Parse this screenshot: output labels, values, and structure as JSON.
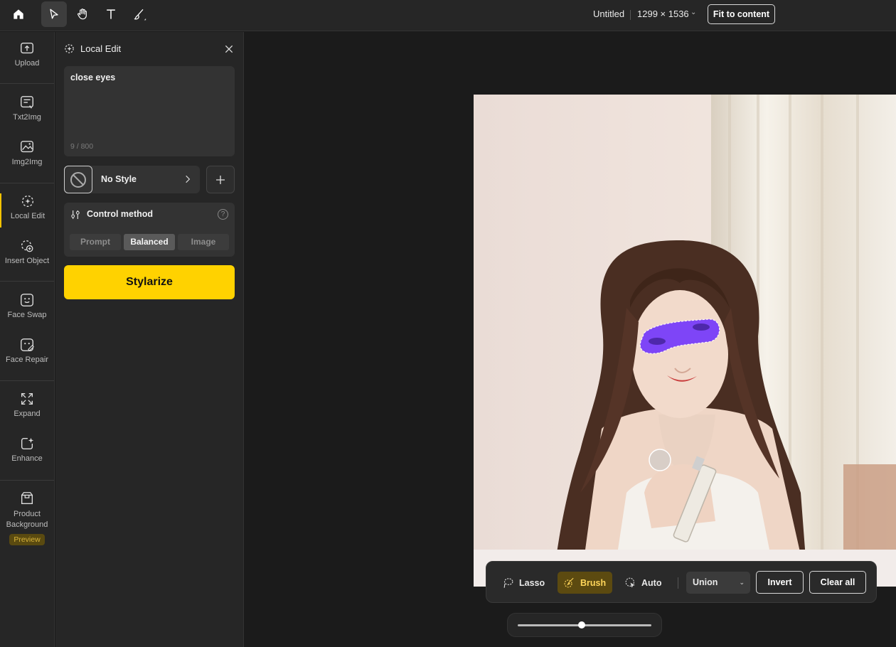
{
  "toolbar": {
    "tools": [
      {
        "icon": "home-icon"
      },
      {
        "icon": "select-arrow-icon",
        "active": true
      },
      {
        "icon": "hand-icon"
      },
      {
        "icon": "text-icon"
      },
      {
        "icon": "brush-icon"
      }
    ],
    "doc_title": "Untitled",
    "doc_size": "1299 × 1536",
    "doc_size_caret": "⌄",
    "fit_label": "Fit to content"
  },
  "nav": {
    "items": [
      {
        "label": "Upload",
        "icon": "upload-icon"
      },
      {
        "label": "Txt2Img",
        "icon": "txt2img-icon"
      },
      {
        "label": "Img2Img",
        "icon": "img2img-icon"
      },
      {
        "label": "Local Edit",
        "icon": "local-edit-icon",
        "active": true
      },
      {
        "label": "Insert Object",
        "icon": "insert-object-icon"
      },
      {
        "label": "Face Swap",
        "icon": "face-swap-icon"
      },
      {
        "label": "Face Repair",
        "icon": "face-repair-icon"
      },
      {
        "label": "Expand",
        "icon": "expand-icon"
      },
      {
        "label": "Enhance",
        "icon": "enhance-icon"
      },
      {
        "label": "Product Background",
        "icon": "product-background-icon",
        "badge": "Preview"
      }
    ],
    "accent": "#f5c400"
  },
  "panel": {
    "title": "Local Edit",
    "prompt": "close eyes",
    "prompt_count": "9 / 800",
    "style_label": "No Style",
    "control": {
      "title": "Control method",
      "options": [
        "Prompt",
        "Balanced",
        "Image"
      ],
      "selected": "Balanced"
    },
    "action_label": "Stylarize",
    "action_color": "#ffd200"
  },
  "selection_tools": {
    "lasso": "Lasso",
    "brush": "Brush",
    "auto": "Auto",
    "mode": "Union",
    "invert": "Invert",
    "clear": "Clear all",
    "selected": "Brush"
  },
  "brush_size_slider": {
    "value": 0.48
  },
  "mask_color": "#6a2cff"
}
